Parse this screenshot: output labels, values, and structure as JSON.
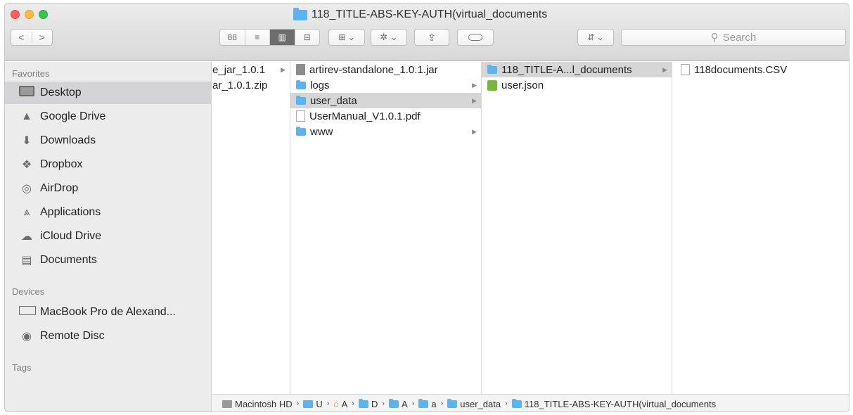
{
  "window": {
    "title": "118_TITLE-ABS-KEY-AUTH(virtual_documents"
  },
  "toolbar": {
    "back": "<",
    "forward": ">",
    "views": [
      "88",
      "≡",
      "▥",
      "⊟"
    ],
    "arrange": "⊞ ⌄",
    "action": "✲ ⌄",
    "share": "⇪",
    "dropbox": "⇵ ⌄",
    "search_placeholder": "Search"
  },
  "sidebar": {
    "favorites_label": "Favorites",
    "favorites": [
      {
        "label": "Desktop",
        "icon": "desktop-icon"
      },
      {
        "label": "Google Drive",
        "icon": "google-drive-icon"
      },
      {
        "label": "Downloads",
        "icon": "downloads-icon"
      },
      {
        "label": "Dropbox",
        "icon": "dropbox-icon"
      },
      {
        "label": "AirDrop",
        "icon": "airdrop-icon"
      },
      {
        "label": "Applications",
        "icon": "applications-icon"
      },
      {
        "label": "iCloud Drive",
        "icon": "icloud-icon"
      },
      {
        "label": "Documents",
        "icon": "documents-icon"
      }
    ],
    "devices_label": "Devices",
    "devices": [
      {
        "label": "MacBook Pro de Alexand...",
        "icon": "laptop-icon"
      },
      {
        "label": "Remote Disc",
        "icon": "disc-icon"
      }
    ],
    "tags_label": "Tags"
  },
  "columns": [
    {
      "items": [
        {
          "name": "e_jar_1.0.1",
          "arrow": "▶"
        },
        {
          "name": "ar_1.0.1.zip",
          "arrow": ""
        }
      ]
    },
    {
      "items": [
        {
          "name": "artirev-standalone_1.0.1.jar",
          "arrow": ""
        },
        {
          "name": "logs",
          "arrow": "▶"
        },
        {
          "name": "user_data",
          "arrow": "▶"
        },
        {
          "name": "UserManual_V1.0.1.pdf",
          "arrow": ""
        },
        {
          "name": "www",
          "arrow": "▶"
        }
      ]
    },
    {
      "items": [
        {
          "name": "118_TITLE-A...l_documents",
          "arrow": "▶"
        },
        {
          "name": "user.json",
          "arrow": ""
        }
      ]
    },
    {
      "items": [
        {
          "name": "118documents.CSV",
          "arrow": ""
        }
      ]
    }
  ],
  "pathbar": {
    "items": [
      "Macintosh HD",
      "U",
      "A",
      "D",
      "A",
      "a",
      "user_data",
      "118_TITLE-ABS-KEY-AUTH(virtual_documents"
    ],
    "separator": "›"
  },
  "colors": {
    "folder": "#5cb3f0",
    "selection": "#d6d6d6",
    "sidebar": "#ececec"
  }
}
